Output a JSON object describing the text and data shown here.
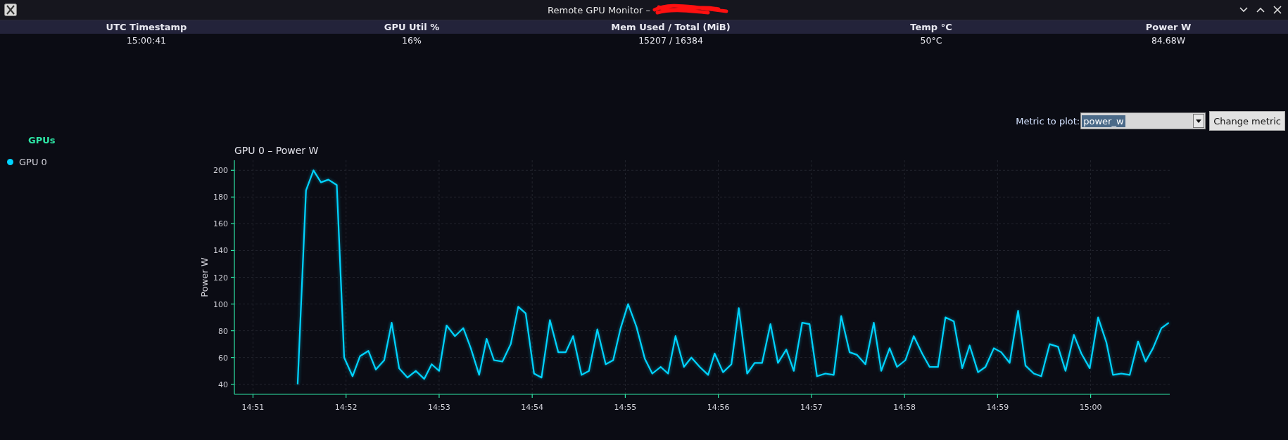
{
  "window": {
    "title": "Remote GPU Monitor –"
  },
  "stats_table": {
    "columns": [
      "UTC Timestamp",
      "GPU Util %",
      "Mem Used / Total (MiB)",
      "Temp °C",
      "Power W"
    ],
    "values": [
      "15:00:41",
      "16%",
      "15207 / 16384",
      "50°C",
      "84.68W"
    ]
  },
  "metric_control": {
    "label": "Metric to plot:",
    "value": "power_w",
    "button": "Change metric"
  },
  "sidebar": {
    "title": "GPUs"
  },
  "chart_data": {
    "type": "line",
    "grid": true,
    "title": "GPU 0 – Power W",
    "ylabel": "Power W",
    "x": [
      891.48,
      891.57,
      891.65,
      891.73,
      891.81,
      891.9,
      891.98,
      892.07,
      892.15,
      892.24,
      892.32,
      892.41,
      892.49,
      892.57,
      892.66,
      892.75,
      892.84,
      892.92,
      893.0,
      893.08,
      893.17,
      893.26,
      893.34,
      893.43,
      893.51,
      893.59,
      893.68,
      893.77,
      893.85,
      893.93,
      894.02,
      894.1,
      894.19,
      894.28,
      894.36,
      894.44,
      894.53,
      894.61,
      894.7,
      894.79,
      894.87,
      894.95,
      895.03,
      895.12,
      895.21,
      895.29,
      895.38,
      895.46,
      895.54,
      895.63,
      895.71,
      895.8,
      895.89,
      895.96,
      896.05,
      896.14,
      896.22,
      896.31,
      896.39,
      896.47,
      896.56,
      896.64,
      896.73,
      896.81,
      896.9,
      896.98,
      897.06,
      897.15,
      897.24,
      897.32,
      897.41,
      897.49,
      897.58,
      897.67,
      897.75,
      897.84,
      897.92,
      898.01,
      898.1,
      898.19,
      898.27,
      898.36,
      898.44,
      898.53,
      898.62,
      898.7,
      898.79,
      898.87,
      898.96,
      899.04,
      899.13,
      899.22,
      899.3,
      899.39,
      899.47,
      899.56,
      899.65,
      899.73,
      899.82,
      899.9,
      899.99,
      900.08,
      900.17,
      900.24,
      900.33,
      900.42,
      900.51,
      900.59,
      900.67,
      900.76,
      900.84
    ],
    "series": [
      {
        "name": "GPU 0",
        "color": "#00d4ff",
        "values": [
          40,
          185,
          200,
          191,
          193,
          189,
          60,
          46,
          61,
          65,
          51,
          58,
          86,
          52,
          45,
          50,
          44,
          55,
          50,
          84,
          76,
          82,
          67,
          47,
          74,
          58,
          57,
          70,
          98,
          93,
          48,
          45,
          88,
          64,
          64,
          76,
          47,
          50,
          81,
          55,
          58,
          82,
          100,
          83,
          59,
          48,
          53,
          48,
          76,
          53,
          60,
          53,
          47,
          63,
          49,
          55,
          97,
          48,
          56,
          56,
          85,
          56,
          66,
          50,
          86,
          85,
          46,
          48,
          47,
          91,
          64,
          62,
          55,
          86,
          50,
          67,
          53,
          58,
          76,
          63,
          53,
          53,
          90,
          87,
          52,
          69,
          49,
          53,
          67,
          64,
          56,
          95,
          54,
          48,
          46,
          70,
          68,
          50,
          77,
          63,
          52,
          90,
          71,
          47,
          48,
          47,
          72,
          57,
          67,
          82,
          86
        ]
      }
    ],
    "xlim": [
      890.8,
      900.85
    ],
    "ylim": [
      32.5,
      207.5
    ],
    "xticks": [
      {
        "value": 891,
        "label": "14:51"
      },
      {
        "value": 892,
        "label": "14:52"
      },
      {
        "value": 893,
        "label": "14:53"
      },
      {
        "value": 894,
        "label": "14:54"
      },
      {
        "value": 895,
        "label": "14:55"
      },
      {
        "value": 896,
        "label": "14:56"
      },
      {
        "value": 897,
        "label": "14:57"
      },
      {
        "value": 898,
        "label": "14:58"
      },
      {
        "value": 899,
        "label": "14:59"
      },
      {
        "value": 900,
        "label": "15:00"
      }
    ],
    "yticks": [
      40,
      60,
      80,
      100,
      120,
      140,
      160,
      180,
      200
    ]
  }
}
